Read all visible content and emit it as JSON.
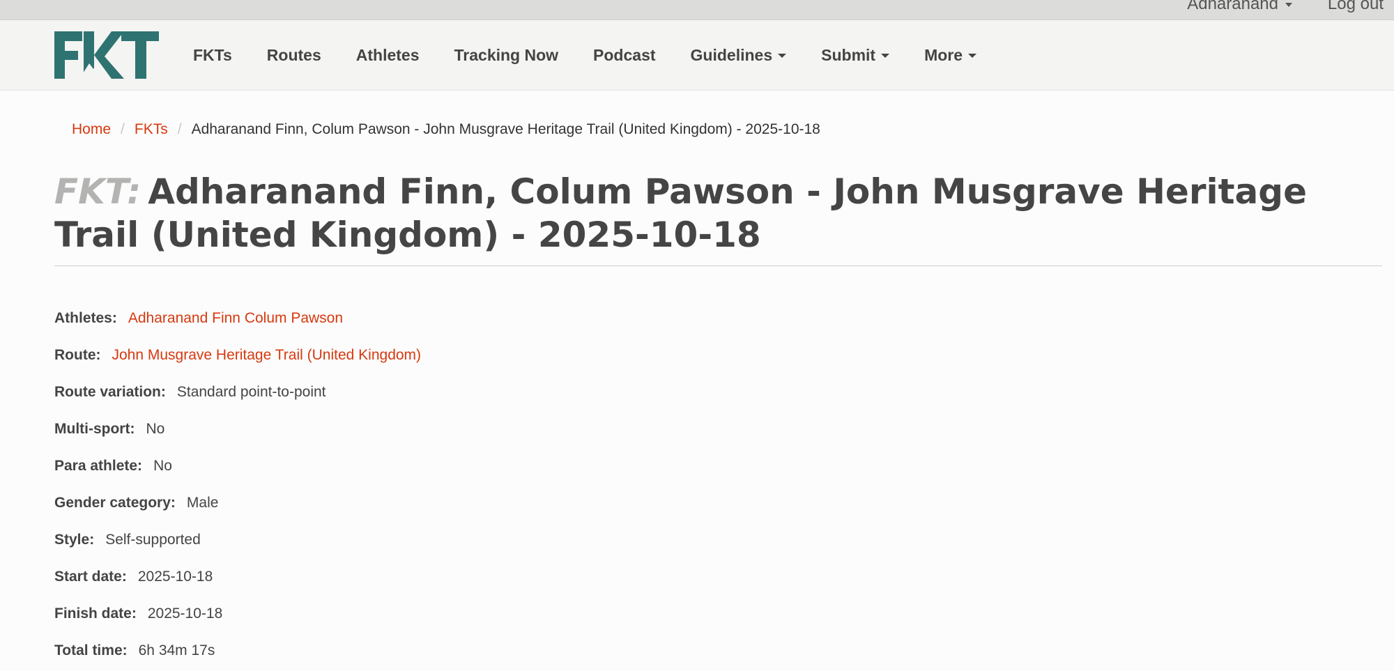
{
  "userbar": {
    "username": "Adharanand",
    "logout": "Log out"
  },
  "brand": {
    "logo_text": "FKT",
    "color": "#2e7372"
  },
  "nav": {
    "items": [
      {
        "label": "FKTs"
      },
      {
        "label": "Routes"
      },
      {
        "label": "Athletes"
      },
      {
        "label": "Tracking Now"
      },
      {
        "label": "Podcast"
      },
      {
        "label": "Guidelines"
      },
      {
        "label": "Submit"
      },
      {
        "label": "More"
      }
    ]
  },
  "breadcrumb": {
    "home": "Home",
    "fkts": "FKTs",
    "current": "Adharanand Finn, Colum Pawson - John Musgrave Heritage Trail (United Kingdom) - 2025-10-18"
  },
  "page": {
    "title_prefix": "FKT:",
    "title": "Adharanand Finn, Colum Pawson - John Musgrave Heritage Trail (United Kingdom) - 2025-10-18"
  },
  "details": {
    "athletes_label": "Athletes:",
    "athletes_value": "Adharanand Finn Colum Pawson",
    "route_label": "Route:",
    "route_value": "John Musgrave Heritage Trail (United Kingdom)",
    "variation_label": "Route variation:",
    "variation_value": "Standard point-to-point",
    "multisport_label": "Multi-sport:",
    "multisport_value": "No",
    "para_label": "Para athlete:",
    "para_value": "No",
    "gender_label": "Gender category:",
    "gender_value": "Male",
    "style_label": "Style:",
    "style_value": "Self-supported",
    "start_label": "Start date:",
    "start_value": "2025-10-18",
    "finish_label": "Finish date:",
    "finish_value": "2025-10-18",
    "time_label": "Total time:",
    "time_value": "6h 34m 17s"
  },
  "colors": {
    "link": "#d6390f",
    "text": "#444444",
    "title_prefix": "#b3b3b1"
  }
}
